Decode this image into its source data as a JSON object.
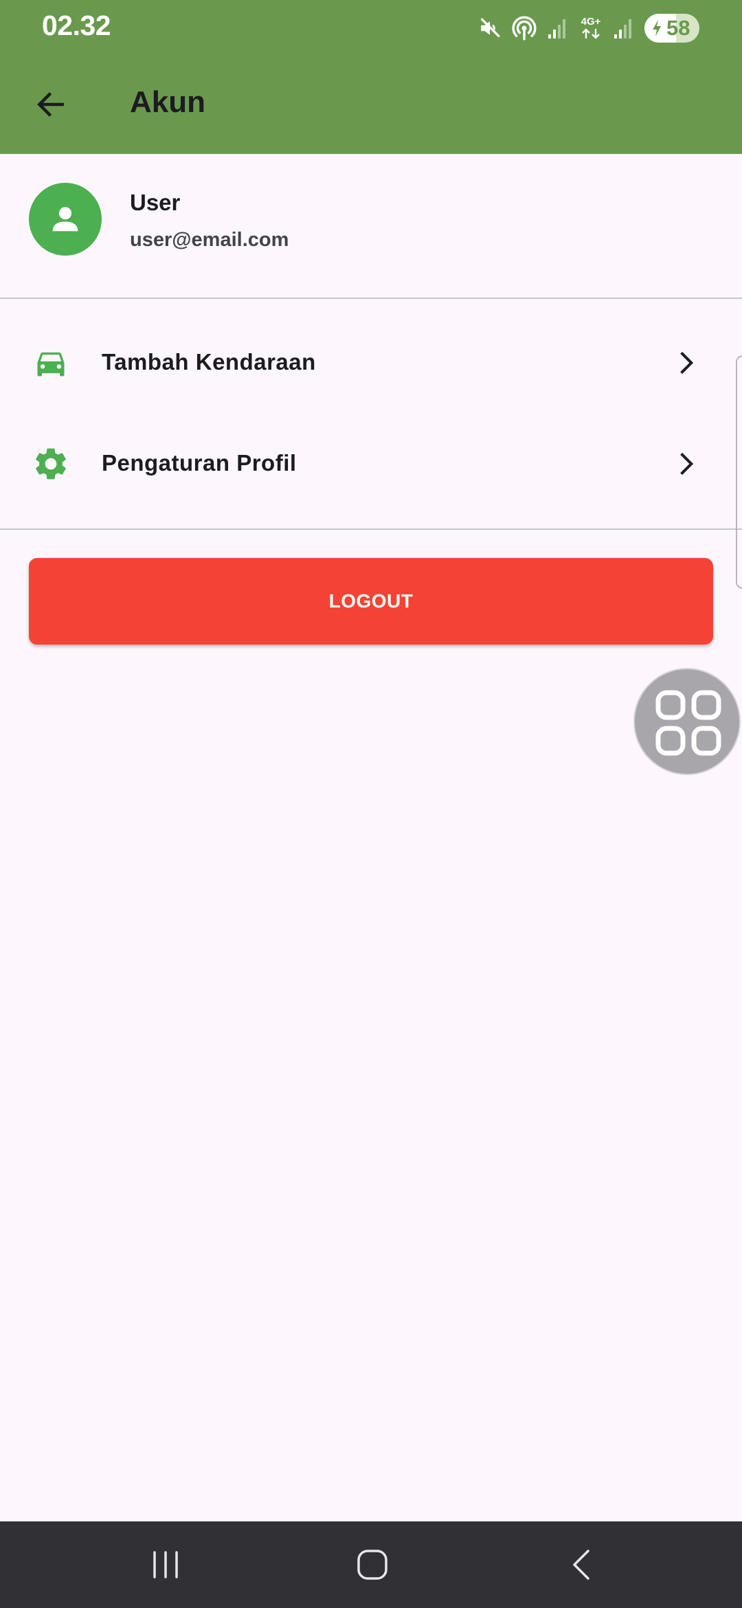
{
  "status_bar": {
    "time": "02.32",
    "network_label": "4G+",
    "battery_percent": "58",
    "battery_level": 0.58,
    "icons": [
      "mute-icon",
      "hotspot-icon",
      "signal-icon",
      "network-4g-icon",
      "signal-icon",
      "battery-charging-icon"
    ]
  },
  "app_bar": {
    "title": "Akun",
    "back_icon": "arrow-left-icon",
    "background_color": "#6a994e"
  },
  "profile": {
    "name": "User",
    "email": "user@email.com",
    "avatar_icon": "person-icon",
    "avatar_color": "#4caf50"
  },
  "menu": {
    "items": [
      {
        "label": "Tambah Kendaraan",
        "icon": "car-icon"
      },
      {
        "label": "Pengaturan Profil",
        "icon": "gear-icon"
      }
    ],
    "chevron_icon": "chevron-right-icon",
    "icon_color": "#4caf50"
  },
  "logout": {
    "label": "LOGOUT",
    "color": "#f44336"
  },
  "floating_button": {
    "icon": "app-grid-icon"
  },
  "nav_bar": {
    "recents_icon": "recents-icon",
    "home_icon": "home-icon",
    "back_icon": "back-icon"
  }
}
